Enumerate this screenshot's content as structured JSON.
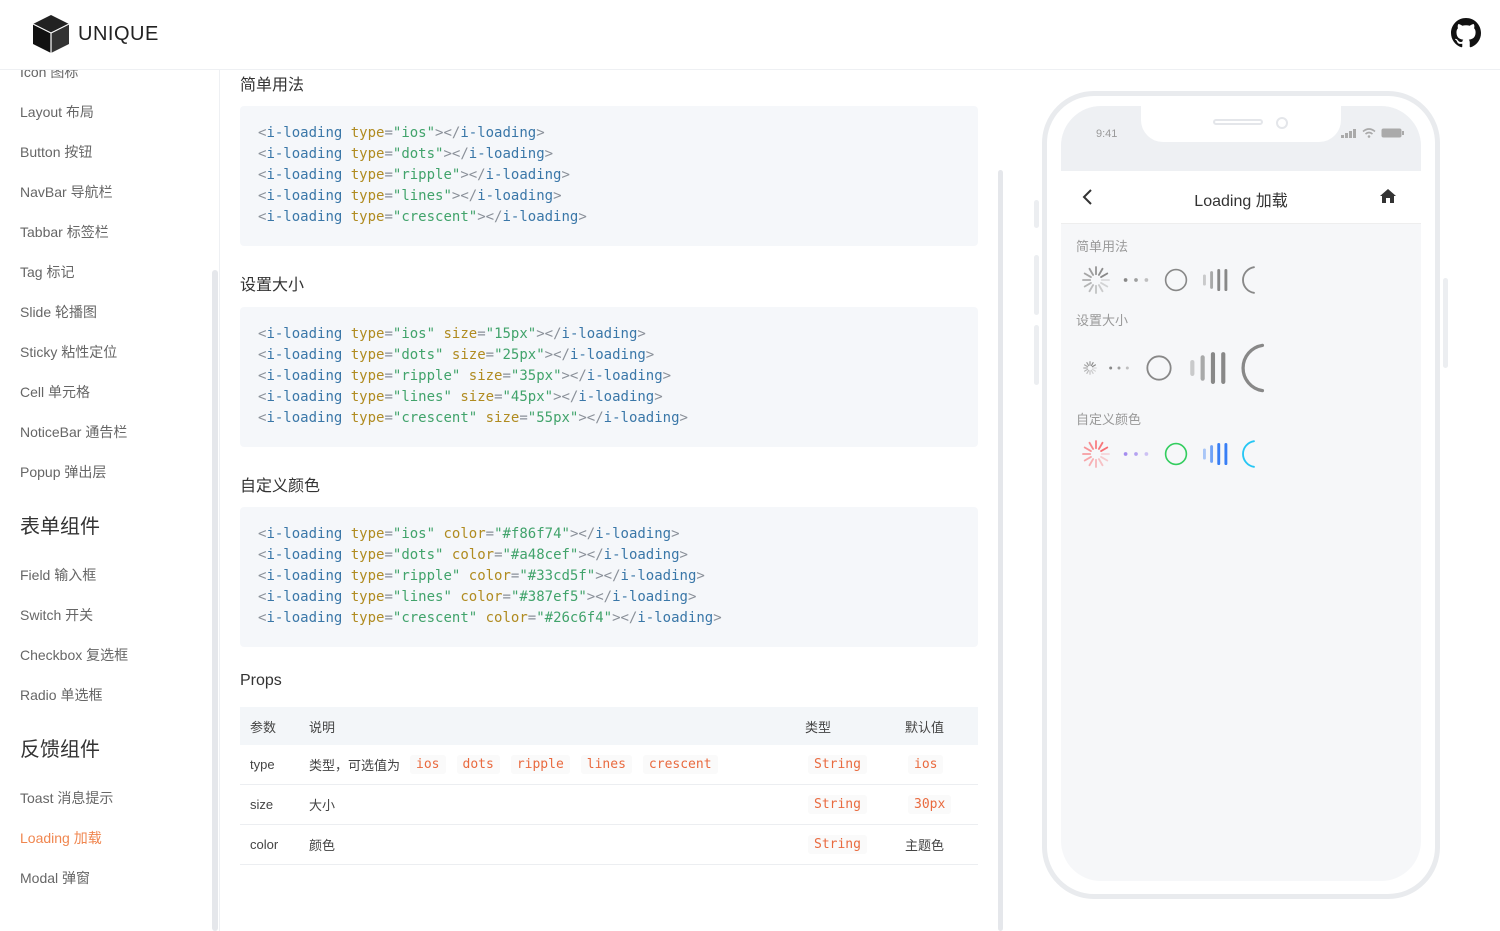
{
  "header": {
    "brand": "UNIQUE"
  },
  "sidebar": {
    "items": [
      {
        "label": "Icon 图标"
      },
      {
        "label": "Layout 布局"
      },
      {
        "label": "Button 按钮"
      },
      {
        "label": "NavBar 导航栏"
      },
      {
        "label": "Tabbar 标签栏"
      },
      {
        "label": "Tag 标记"
      },
      {
        "label": "Slide 轮播图"
      },
      {
        "label": "Sticky 粘性定位"
      },
      {
        "label": "Cell 单元格"
      },
      {
        "label": "NoticeBar 通告栏"
      },
      {
        "label": "Popup 弹出层"
      }
    ],
    "group_form": "表单组件",
    "form_items": [
      {
        "label": "Field 输入框"
      },
      {
        "label": "Switch 开关"
      },
      {
        "label": "Checkbox 复选框"
      },
      {
        "label": "Radio 单选框"
      }
    ],
    "group_feedback": "反馈组件",
    "feedback_items": [
      {
        "label": "Toast 消息提示"
      },
      {
        "label": "Loading 加载",
        "active": true
      },
      {
        "label": "Modal 弹窗"
      }
    ]
  },
  "sections": {
    "basic_title": "简单用法",
    "basic_code": [
      {
        "type": "ios",
        "extra": ""
      },
      {
        "type": "dots",
        "extra": ""
      },
      {
        "type": "ripple",
        "extra": ""
      },
      {
        "type": "lines",
        "extra": ""
      },
      {
        "type": "crescent",
        "extra": ""
      }
    ],
    "size_title": "设置大小",
    "size_code": [
      {
        "type": "ios",
        "attr": "size",
        "value": "15px"
      },
      {
        "type": "dots",
        "attr": "size",
        "value": "25px"
      },
      {
        "type": "ripple",
        "attr": "size",
        "value": "35px"
      },
      {
        "type": "lines",
        "attr": "size",
        "value": "45px"
      },
      {
        "type": "crescent",
        "attr": "size",
        "value": "55px"
      }
    ],
    "color_title": "自定义颜色",
    "color_code": [
      {
        "type": "ios",
        "attr": "color",
        "value": "#f86f74"
      },
      {
        "type": "dots",
        "attr": "color",
        "value": "#a48cef"
      },
      {
        "type": "ripple",
        "attr": "color",
        "value": "#33cd5f"
      },
      {
        "type": "lines",
        "attr": "color",
        "value": "#387ef5"
      },
      {
        "type": "crescent",
        "attr": "color",
        "value": "#26c6f4"
      }
    ],
    "props_title": "Props"
  },
  "props": {
    "headers": [
      "参数",
      "说明",
      "类型",
      "默认值"
    ],
    "rows": [
      {
        "param": "type",
        "desc": "类型，可选值为",
        "chips": [
          "ios",
          "dots",
          "ripple",
          "lines",
          "crescent"
        ],
        "type": "String",
        "default": "ios",
        "default_code": true
      },
      {
        "param": "size",
        "desc": "大小",
        "chips": [],
        "type": "String",
        "default": "30px",
        "default_code": true
      },
      {
        "param": "color",
        "desc": "颜色",
        "chips": [],
        "type": "String",
        "default": "主题色",
        "default_code": false
      }
    ]
  },
  "phone": {
    "time": "9:41",
    "title": "Loading 加载",
    "demo_basic": "简单用法",
    "demo_size": "设置大小",
    "demo_color": "自定义颜色"
  },
  "colors": {
    "active": "#f0864f",
    "custom": [
      "#f86f74",
      "#a48cef",
      "#33cd5f",
      "#387ef5",
      "#26c6f4"
    ],
    "default_spinner": "#888888"
  }
}
